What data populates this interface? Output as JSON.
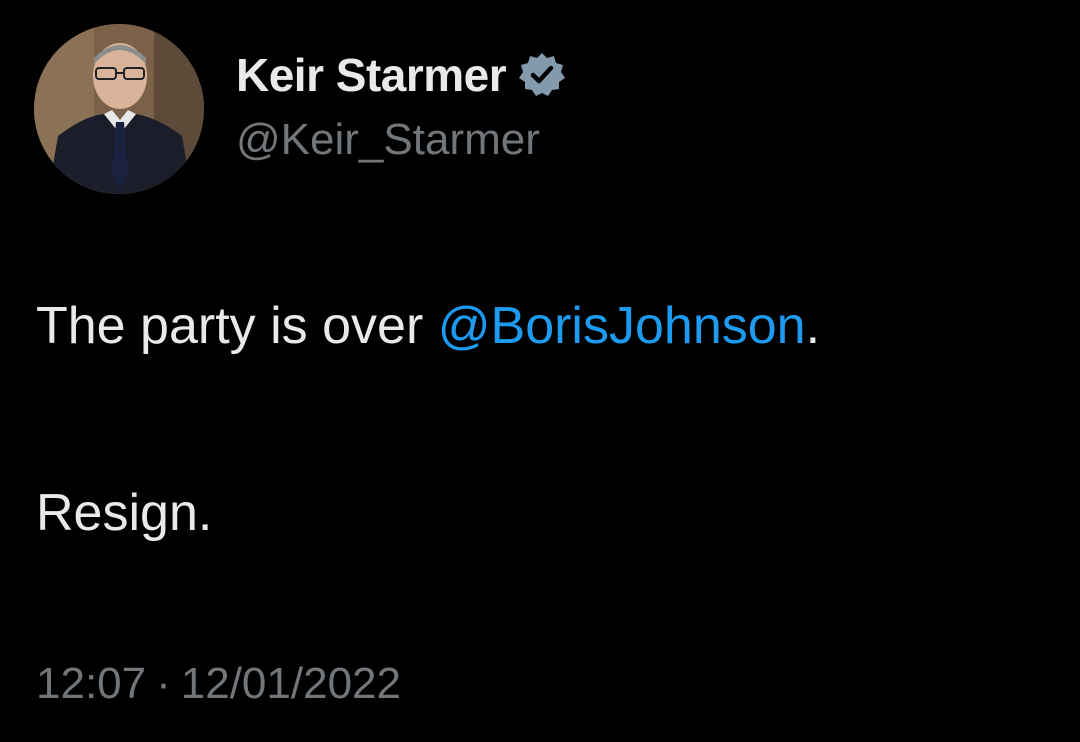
{
  "author": {
    "display_name": "Keir Starmer",
    "handle": "@Keir_Starmer",
    "verified_icon": "verified-badge-icon",
    "avatar_icon": "avatar-photo"
  },
  "tweet": {
    "text_before_mention": "The party is over ",
    "mention": "@BorisJohnson",
    "text_after_mention": ".",
    "second_paragraph": "Resign."
  },
  "meta": {
    "time": "12:07",
    "separator": "·",
    "date": "12/01/2022"
  },
  "colors": {
    "background": "#000000",
    "primary_text": "#e7e9ea",
    "secondary_text": "#71767b",
    "link": "#1d9bf0",
    "badge": "#829aab"
  }
}
